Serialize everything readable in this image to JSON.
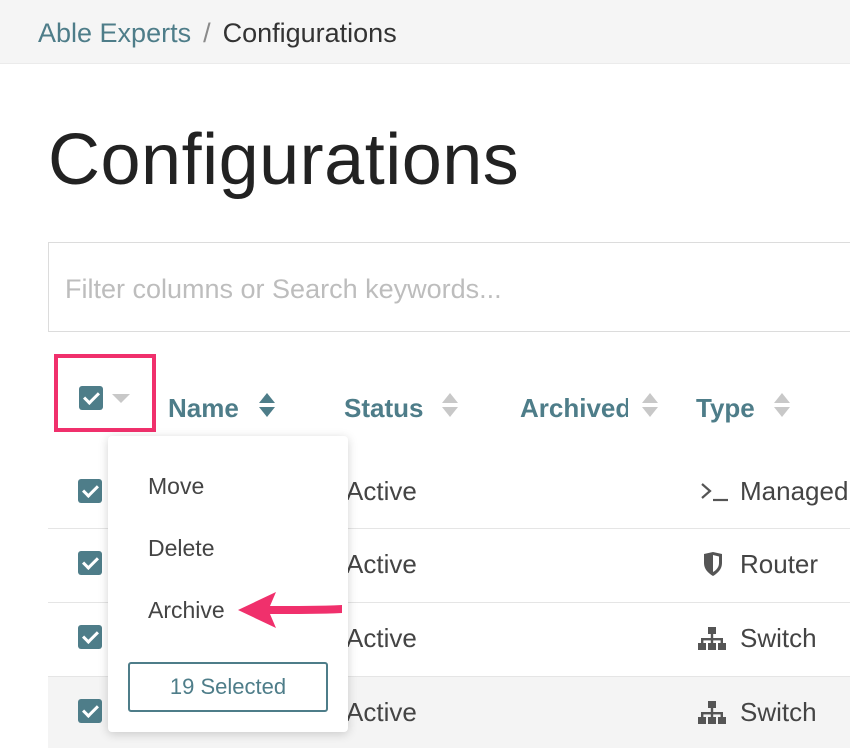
{
  "breadcrumb": {
    "parent": "Able Experts",
    "separator": "/",
    "current": "Configurations"
  },
  "page": {
    "title": "Configurations"
  },
  "search": {
    "placeholder": "Filter columns or Search keywords..."
  },
  "columns": [
    {
      "label": "Name",
      "sort": "active"
    },
    {
      "label": "Status",
      "sort": "none"
    },
    {
      "label": "Archived",
      "sort": "none"
    },
    {
      "label": "Type",
      "sort": "none"
    }
  ],
  "bulk_menu": {
    "items": [
      "Move",
      "Delete",
      "Archive"
    ],
    "selected_label": "19 Selected"
  },
  "rows": [
    {
      "status": "Active",
      "type": "Managed",
      "type_icon": "terminal-icon"
    },
    {
      "status": "Active",
      "type": "Router",
      "type_icon": "shield-icon"
    },
    {
      "status": "Active",
      "type": "Switch",
      "type_icon": "network-icon"
    },
    {
      "status": "Active",
      "type": "Switch",
      "type_icon": "network-icon"
    }
  ],
  "colors": {
    "accent": "#4e7d89",
    "highlight": "#f0306c"
  }
}
